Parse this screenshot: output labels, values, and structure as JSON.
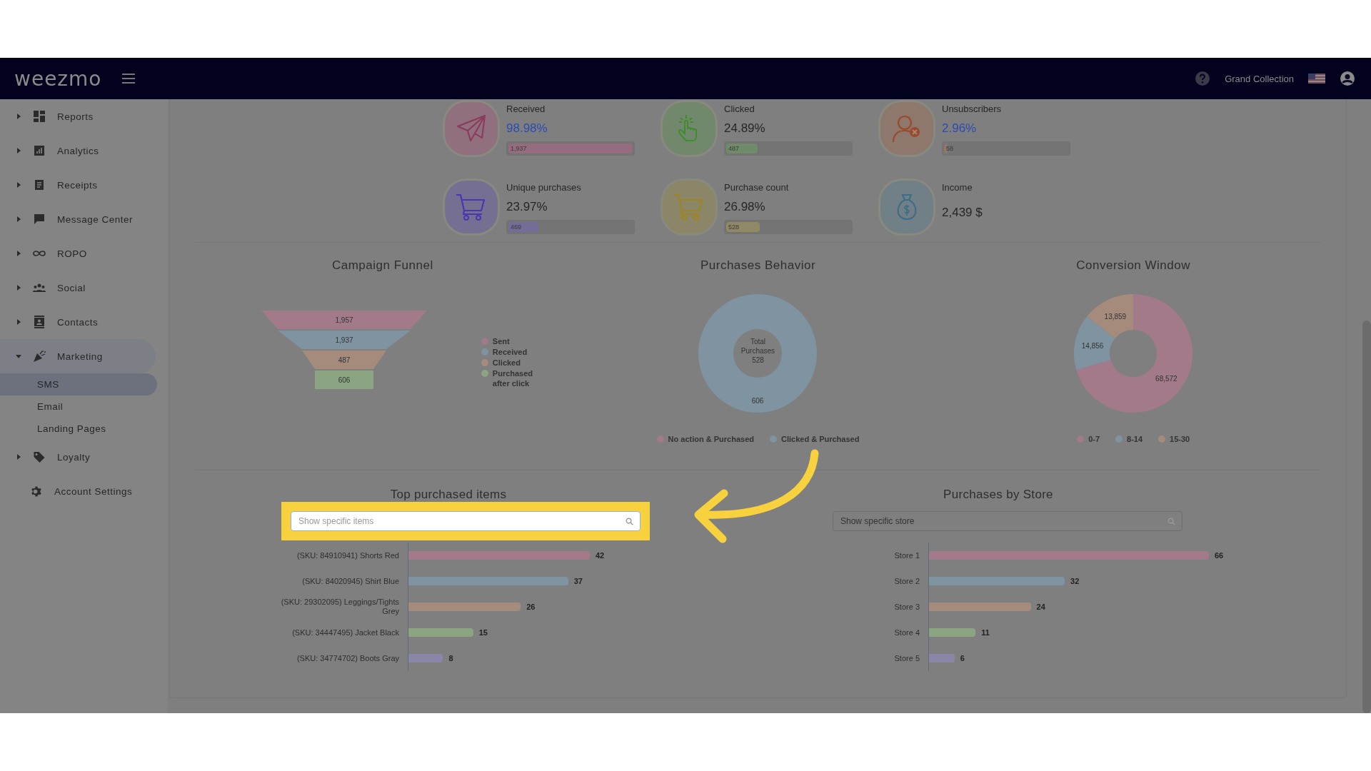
{
  "header": {
    "logo": "weezmo",
    "account": "Grand Collection"
  },
  "sidebar": {
    "items": [
      {
        "label": "Reports",
        "expanded": false
      },
      {
        "label": "Analytics",
        "expanded": false
      },
      {
        "label": "Receipts",
        "expanded": false
      },
      {
        "label": "Message Center",
        "expanded": false
      },
      {
        "label": "ROPO",
        "expanded": false
      },
      {
        "label": "Social",
        "expanded": false
      },
      {
        "label": "Contacts",
        "expanded": false
      },
      {
        "label": "Marketing",
        "expanded": true,
        "children": [
          {
            "label": "SMS",
            "selected": true
          },
          {
            "label": "Email",
            "selected": false
          },
          {
            "label": "Landing Pages",
            "selected": false
          }
        ]
      },
      {
        "label": "Loyalty",
        "expanded": false
      },
      {
        "label": "Account Settings"
      }
    ]
  },
  "stats": [
    {
      "label": "Received",
      "value": "98.98%",
      "highlighted": true,
      "count": "1,937",
      "level": 1
    },
    {
      "label": "Clicked",
      "value": "24.89%",
      "highlighted": false,
      "count": "487",
      "level": 0.25
    },
    {
      "label": "Unsubscribers",
      "value": "2.96%",
      "highlighted": true,
      "count": "58",
      "level": 0.03
    },
    {
      "label": "Unique purchases",
      "value": "23.97%",
      "highlighted": false,
      "count": "469",
      "level": 0.24
    },
    {
      "label": "Purchase count",
      "value": "26.98%",
      "highlighted": false,
      "count": "528",
      "level": 0.27
    },
    {
      "label": "Income",
      "value": "2,439 $",
      "highlighted": false
    }
  ],
  "funnel": {
    "title": "Campaign Funnel",
    "stages": [
      {
        "label": "Sent",
        "value": "1,957"
      },
      {
        "label": "Received",
        "value": "1,937"
      },
      {
        "label": "Clicked",
        "value": "487"
      },
      {
        "label": "Purchased after click",
        "value": "606"
      }
    ]
  },
  "behavior": {
    "title": "Purchases Behavior",
    "center_label": "Total Purchases",
    "center_value": "528",
    "chart_data": {
      "type": "pie",
      "categories": [
        "No action & Purchased",
        "Clicked & Purchased"
      ],
      "values": [
        0,
        606
      ],
      "value_labels": [
        null,
        "606"
      ]
    }
  },
  "conversion": {
    "title": "Conversion Window",
    "chart_data": {
      "type": "donut",
      "categories": [
        "0-7",
        "8-14",
        "15-30"
      ],
      "values": [
        68572,
        14856,
        13859
      ],
      "value_labels": [
        "68,572",
        "14,856",
        "13,859"
      ]
    }
  },
  "top_items": {
    "title": "Top purchased items",
    "search": {
      "placeholder": "Show specific items",
      "highlighted": true
    },
    "chart_data": {
      "type": "bar",
      "orientation": "horizontal",
      "categories": [
        "(SKU: 84910941) Shorts Red",
        "(SKU: 84020945) Shirt Blue",
        "(SKU: 29302095) Leggings/Tights Grey",
        "(SKU: 34447495) Jacket Black",
        "(SKU: 34774702) Boots Gray"
      ],
      "values": [
        42,
        37,
        26,
        15,
        8
      ],
      "data_labels": true
    }
  },
  "stores": {
    "title": "Purchases by Store",
    "search": {
      "placeholder": "Show specific store",
      "highlighted": false
    },
    "chart_data": {
      "type": "bar",
      "orientation": "horizontal",
      "categories": [
        "Store 1",
        "Store 2",
        "Store 3",
        "Store 4",
        "Store 5"
      ],
      "values": [
        66,
        32,
        24,
        11,
        6
      ],
      "data_labels": true
    }
  }
}
